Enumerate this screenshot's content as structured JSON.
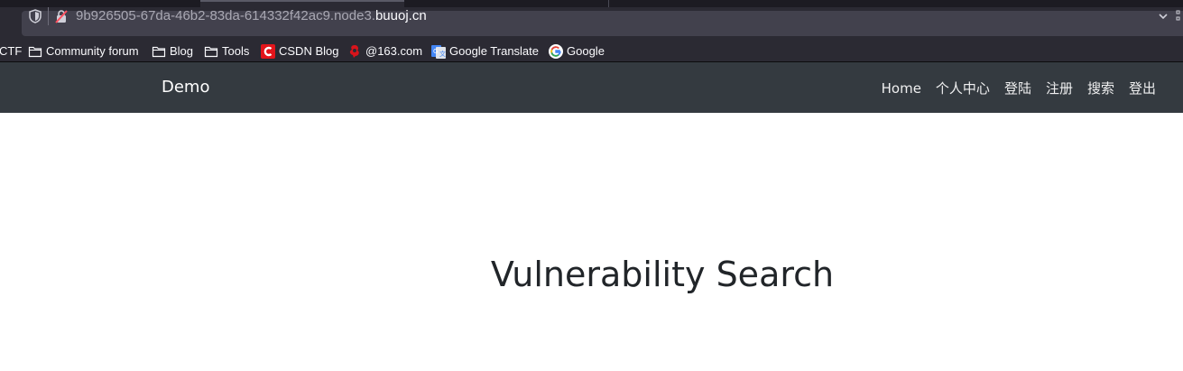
{
  "browser": {
    "url_prefix": "9b926505-67da-46b2-83da-614332f42ac9.node3.",
    "url_domain": "buuoj.cn",
    "icons": {
      "tracking": "shield-icon",
      "security": "insecure-lock-icon",
      "dropdown": "chevron-down-icon"
    }
  },
  "bookmarks": [
    {
      "label": "CTF",
      "icon": "folder-icon"
    },
    {
      "label": "Community forum",
      "icon": "folder-icon"
    },
    {
      "label": "Blog",
      "icon": "folder-icon"
    },
    {
      "label": "Tools",
      "icon": "folder-icon"
    },
    {
      "label": "CSDN Blog",
      "icon": "csdn-logo-icon"
    },
    {
      "label": "@163.com",
      "icon": "netease-logo-icon"
    },
    {
      "label": "Google Translate",
      "icon": "google-translate-icon"
    },
    {
      "label": "Google",
      "icon": "google-logo-icon"
    }
  ],
  "navbar": {
    "brand": "Demo",
    "links": [
      "Home",
      "个人中心",
      "登陆",
      "注册",
      "搜索",
      "登出"
    ]
  },
  "main": {
    "heading": "Vulnerability Search"
  },
  "colors": {
    "navbar_bg": "#343a40",
    "chrome_bg": "#2b2a33",
    "urlbar_bg": "#42414d",
    "heading_text": "#212529"
  }
}
